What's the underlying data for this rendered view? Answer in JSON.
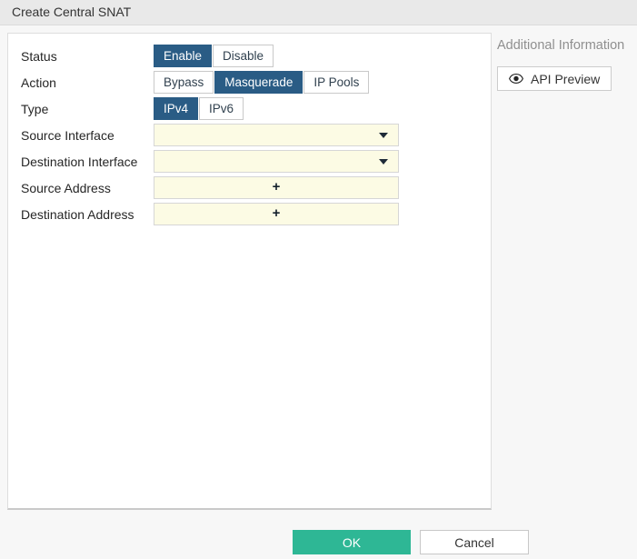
{
  "window": {
    "title": "Create Central SNAT"
  },
  "colors": {
    "accent_blue": "#2a5c85",
    "ok_green": "#2eb795",
    "field_bg": "#fcfbe4",
    "titlebar_bg": "#e9e9e9"
  },
  "form": {
    "rows": [
      {
        "label": "Status",
        "type": "toggle",
        "options": [
          "Enable",
          "Disable"
        ],
        "selected": "Enable"
      },
      {
        "label": "Action",
        "type": "toggle",
        "options": [
          "Bypass",
          "Masquerade",
          "IP Pools"
        ],
        "selected": "Masquerade"
      },
      {
        "label": "Type",
        "type": "toggle",
        "options": [
          "IPv4",
          "IPv6"
        ],
        "selected": "IPv4"
      },
      {
        "label": "Source Interface",
        "type": "dropdown",
        "value": ""
      },
      {
        "label": "Destination Interface",
        "type": "dropdown",
        "value": ""
      },
      {
        "label": "Source Address",
        "type": "add",
        "add_label": "+"
      },
      {
        "label": "Destination Address",
        "type": "add",
        "add_label": "+"
      }
    ]
  },
  "sidebar": {
    "heading": "Additional Information",
    "api_preview_label": "API Preview",
    "icons": {
      "api_preview": "eye-icon"
    }
  },
  "footer": {
    "ok_label": "OK",
    "cancel_label": "Cancel"
  }
}
